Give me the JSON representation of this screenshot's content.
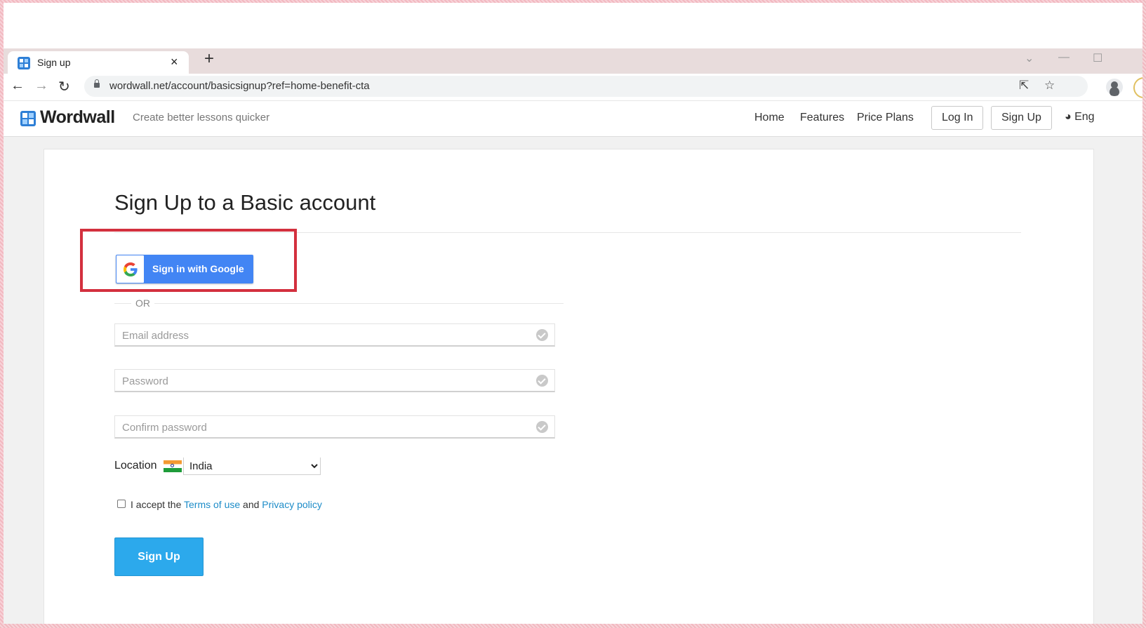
{
  "browser": {
    "tab_title": "Sign up",
    "tab_close": "×",
    "new_tab": "+",
    "url": "wordwall.net/account/basicsignup?ref=home-benefit-cta"
  },
  "site": {
    "logo_text": "Wordwall",
    "tagline": "Create better lessons quicker",
    "nav": {
      "home": "Home",
      "features": "Features",
      "price_plans": "Price Plans"
    },
    "login_label": "Log In",
    "signup_label": "Sign Up",
    "language": "Eng"
  },
  "form": {
    "title": "Sign Up to a Basic account",
    "google_label": "Sign in with Google",
    "or_text": "OR",
    "email_placeholder": "Email address",
    "password_placeholder": "Password",
    "confirm_placeholder": "Confirm password",
    "location_label": "Location",
    "location_value": "India",
    "terms_prefix": "I accept the ",
    "terms_link": "Terms of use",
    "terms_and": " and ",
    "privacy_link": "Privacy policy",
    "submit_label": "Sign Up"
  },
  "colors": {
    "highlight": "#d3303e",
    "google_blue": "#4285f4",
    "primary_button": "#2ca9ec",
    "link": "#1d8cc8"
  }
}
